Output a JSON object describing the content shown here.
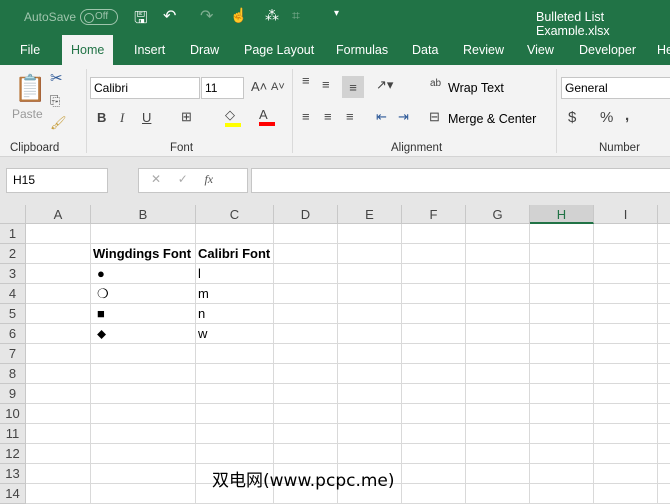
{
  "title_bar": {
    "autosave": "AutoSave",
    "autosave_state": "Off",
    "filename": "Bulleted List Example.xlsx"
  },
  "tabs": [
    "File",
    "Home",
    "Insert",
    "Draw",
    "Page Layout",
    "Formulas",
    "Data",
    "Review",
    "View",
    "Developer",
    "He"
  ],
  "ribbon": {
    "paste": "Paste",
    "font_name": "Calibri",
    "font_size": "11",
    "wrap_text": "Wrap Text",
    "merge_center": "Merge & Center",
    "number_format": "General",
    "bold": "B",
    "italic": "I",
    "underline": "U",
    "currency": "$",
    "percent": "%",
    "comma": ",",
    "groups": [
      "Clipboard",
      "Font",
      "Alignment",
      "Number"
    ],
    "highlight_color": "#ffff00",
    "font_color": "#ff0000"
  },
  "formula_bar": {
    "name_box": "H15",
    "fx": "fx",
    "value": ""
  },
  "columns": [
    "A",
    "B",
    "C",
    "D",
    "E",
    "F",
    "G",
    "H",
    "I"
  ],
  "selected_column": "H",
  "rows": [
    "1",
    "2",
    "3",
    "4",
    "5",
    "6",
    "7",
    "8",
    "9",
    "10",
    "11",
    "12",
    "13",
    "14"
  ],
  "cells": {
    "B2": "Wingdings Font",
    "C2": "Calibri Font",
    "B3": "●",
    "C3": "l",
    "B4": "❍",
    "C4": "m",
    "B5": "■",
    "C5": "n",
    "B6": "⬥",
    "C6": "w"
  },
  "watermark": "双电网(www.pcpc.me)"
}
